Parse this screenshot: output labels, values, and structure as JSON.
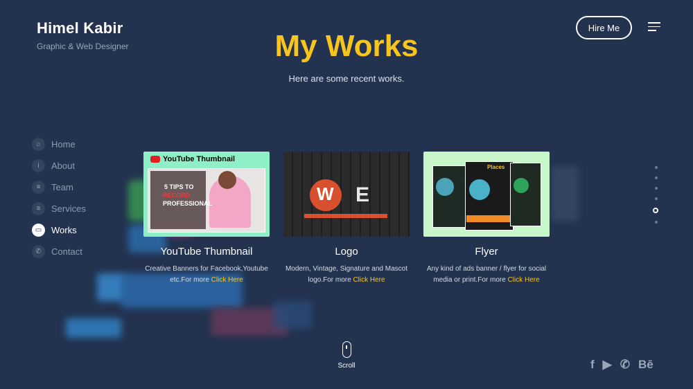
{
  "brand": {
    "name": "Himel Kabir",
    "tagline": "Graphic & Web Designer"
  },
  "header": {
    "hire_label": "Hire Me"
  },
  "section": {
    "title": "My Works",
    "subtitle": "Here are some recent works."
  },
  "nav": {
    "items": [
      {
        "label": "Home",
        "icon": "home-icon"
      },
      {
        "label": "About",
        "icon": "info-icon"
      },
      {
        "label": "Team",
        "icon": "team-icon"
      },
      {
        "label": "Services",
        "icon": "services-icon"
      },
      {
        "label": "Works",
        "icon": "works-icon",
        "active": true
      },
      {
        "label": "Contact",
        "icon": "phone-icon"
      }
    ]
  },
  "works": [
    {
      "title": "YouTube Thumbnail",
      "desc": "Creative Banners for Facebook,Youtube etc.For more",
      "link": "Click Here",
      "thumb_text": {
        "heading": "YouTube Thumbnail",
        "line1": "5 TIPS TO",
        "line2": "RECORD",
        "line3": "PROFESSIONAL"
      }
    },
    {
      "title": "Logo",
      "desc": "Modern, Vintage, Signature and Mascot logo.For more",
      "link": "Click Here"
    },
    {
      "title": "Flyer",
      "desc": "Any kind of ads banner / flyer for social media or print.For more",
      "link": "Click Here",
      "thumb_text": {
        "label": "Places"
      }
    }
  ],
  "scroll": {
    "label": "Scroll"
  },
  "social": [
    "f",
    "▶",
    "✆",
    "Bē"
  ],
  "colors": {
    "accent": "#f8c51c",
    "background": "#22324f"
  }
}
